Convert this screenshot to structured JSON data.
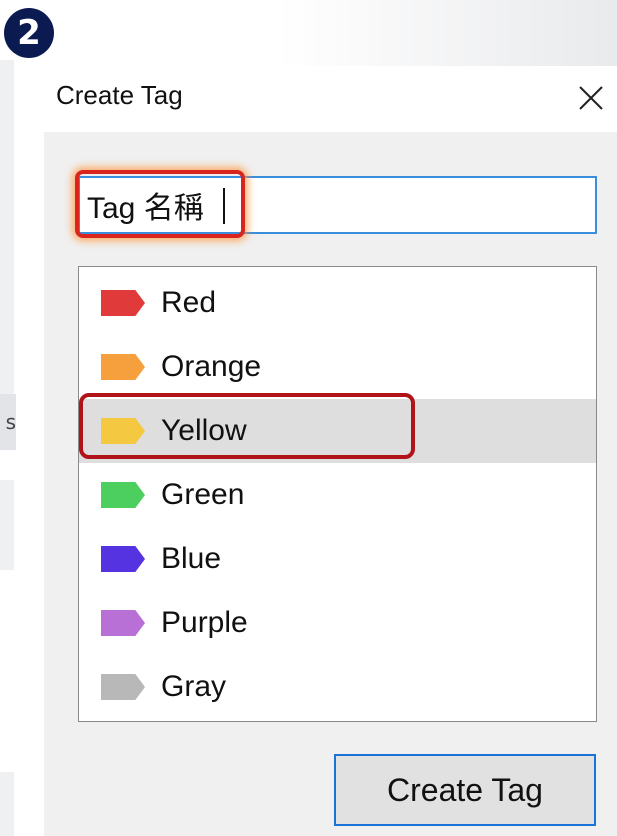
{
  "step_badge": "2",
  "dialog": {
    "title": "Create Tag",
    "close_icon": "close-icon",
    "name_input_value": "Tag 名稱",
    "tags": [
      {
        "label": "Red",
        "color": "#e03a3a"
      },
      {
        "label": "Orange",
        "color": "#f5a03c"
      },
      {
        "label": "Yellow",
        "color": "#f5c842"
      },
      {
        "label": "Green",
        "color": "#4ccf5f"
      },
      {
        "label": "Blue",
        "color": "#5533e0"
      },
      {
        "label": "Purple",
        "color": "#b86fd6"
      },
      {
        "label": "Gray",
        "color": "#b8b8b8"
      }
    ],
    "selected_tag": "Yellow",
    "create_button_label": "Create Tag"
  },
  "backdrop": {
    "partial_label": "s"
  },
  "colors": {
    "badge_bg": "#0b1b52",
    "input_border": "#3b8ede",
    "highlight_red": "#d9251d",
    "button_border": "#1a73d6"
  }
}
